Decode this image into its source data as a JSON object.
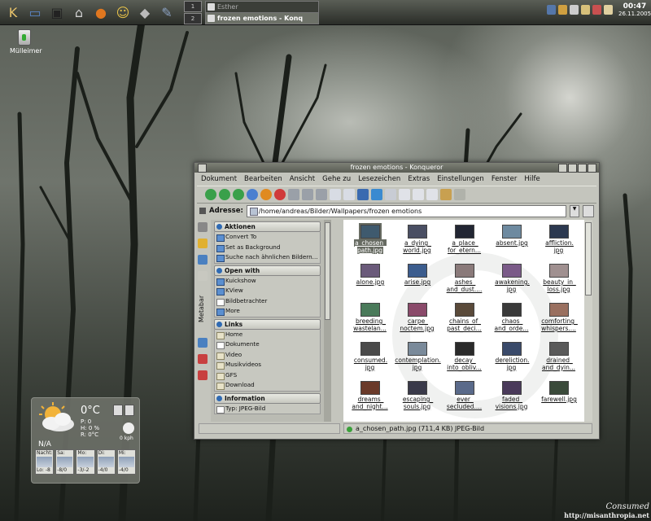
{
  "panel": {
    "launchers": [
      {
        "name": "k-menu-icon",
        "color": "#e8c36a",
        "glyph": "K"
      },
      {
        "name": "desktop-icon",
        "color": "#5b86c6",
        "glyph": "▭"
      },
      {
        "name": "terminal-icon",
        "color": "#222222",
        "glyph": "▣"
      },
      {
        "name": "home-icon",
        "color": "#cfcfcf",
        "glyph": "⌂"
      },
      {
        "name": "firefox-icon",
        "color": "#e0771f",
        "glyph": "●"
      },
      {
        "name": "messenger-icon",
        "color": "#e7c24a",
        "glyph": "☺"
      },
      {
        "name": "eraser-icon",
        "color": "#bbbbbb",
        "glyph": "◆"
      },
      {
        "name": "editor-icon",
        "color": "#8aa0c0",
        "glyph": "✎"
      }
    ],
    "pager": [
      "1",
      "2"
    ],
    "tasks": [
      "Esther",
      "frozen emotions - Konq"
    ],
    "clock_time": "00:47",
    "clock_date": "26.11.2005"
  },
  "desktop": {
    "trash_label": "Mülleimer"
  },
  "weather": {
    "temp": "0°C",
    "p": "P: 0",
    "h": "H: 0 %",
    "r": "R: 0°C",
    "na": "N/A",
    "wind": "0 kph",
    "days": [
      {
        "name": "Nacht:",
        "temp": "Lo: -8"
      },
      {
        "name": "Sa:",
        "temp": "-8/0"
      },
      {
        "name": "Mo:",
        "temp": "-3/-2"
      },
      {
        "name": "Di:",
        "temp": "-4/0"
      },
      {
        "name": "Mi:",
        "temp": "-4/0"
      }
    ]
  },
  "konqueror": {
    "title": "frozen emotions - Konqueror",
    "menu": [
      "Dokument",
      "Bearbeiten",
      "Ansicht",
      "Gehe zu",
      "Lesezeichen",
      "Extras",
      "Einstellungen",
      "Fenster",
      "Hilfe"
    ],
    "address_label": "Adresse:",
    "address": "/home/andreas/Bilder/Wallpapers/frozen emotions",
    "metabar_label": "Metabar",
    "sections": [
      {
        "title": "Aktionen",
        "items": [
          "Convert To",
          "Set as Background",
          "Suche nach ähnlichen Bildern..."
        ]
      },
      {
        "title": "Open with",
        "items": [
          "Kuickshow",
          "KView",
          "Bildbetrachter",
          "More"
        ]
      },
      {
        "title": "Links",
        "items": [
          "Home",
          "Dokumente",
          "Video",
          "Musikvideos",
          "GFS",
          "Download"
        ]
      },
      {
        "title": "Information",
        "items": [
          "Typ: JPEG-Bild"
        ]
      }
    ],
    "files": [
      {
        "name": "a_chosen_\npath.jpg",
        "color": "#3f5a6e",
        "selected": true
      },
      {
        "name": "a_dying_\nworld.jpg",
        "color": "#4a4f63"
      },
      {
        "name": "a_place_\nfor_etern...",
        "color": "#222633"
      },
      {
        "name": "absent.jpg",
        "color": "#6e8aa0"
      },
      {
        "name": "affliction.\njpg",
        "color": "#2c3950"
      },
      {
        "name": "alone.jpg",
        "color": "#6a5a7a"
      },
      {
        "name": "arise.jpg",
        "color": "#3c5d8e"
      },
      {
        "name": "ashes_\nand_dust....",
        "color": "#8a7a7a"
      },
      {
        "name": "awakening.\njpg",
        "color": "#7a5a88"
      },
      {
        "name": "beauty_in_\nloss.jpg",
        "color": "#a09090"
      },
      {
        "name": "breeding_\nwastelan...",
        "color": "#4a7a5a"
      },
      {
        "name": "carpe_\nnoctem.jpg",
        "color": "#8a4a6a"
      },
      {
        "name": "chains_of_\npast_deci...",
        "color": "#5a4a3a"
      },
      {
        "name": "chaos_\nand_orde...",
        "color": "#3a3a3a"
      },
      {
        "name": "comforting_\nwhispers....",
        "color": "#9a7060"
      },
      {
        "name": "consumed.\njpg",
        "color": "#4a4a4a"
      },
      {
        "name": "contemplation.\njpg",
        "color": "#7a8a9a"
      },
      {
        "name": "decay_\ninto_obliv...",
        "color": "#2a2a2a"
      },
      {
        "name": "dereliction.\njpg",
        "color": "#3a4a6a"
      },
      {
        "name": "drained_\nand_dyin...",
        "color": "#5a5a5a"
      },
      {
        "name": "dreams_\nand_night...",
        "color": "#6a3a2a"
      },
      {
        "name": "escaping_\nsouls.jpg",
        "color": "#3a3a4a"
      },
      {
        "name": "ever_\nsecluded....",
        "color": "#5a6a8a"
      },
      {
        "name": "faded_\nvisions.jpg",
        "color": "#4a3a5a"
      },
      {
        "name": "farewell.jpg",
        "color": "#3a4a3a"
      }
    ],
    "status": "a_chosen_path.jpg (711,4 KB)  JPEG-Bild"
  },
  "signature": {
    "line1": "Consumed",
    "line2": "http://misanthropia.net"
  }
}
